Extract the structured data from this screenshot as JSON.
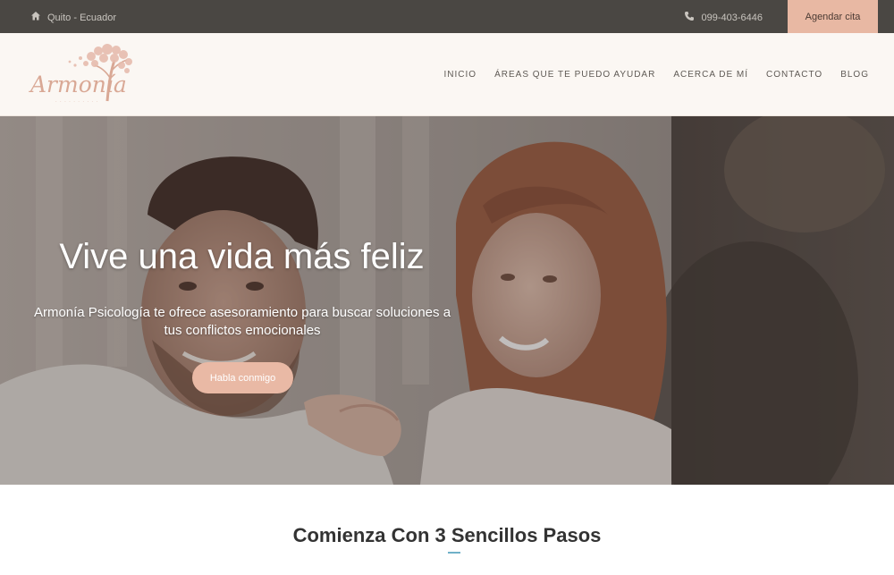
{
  "topbar": {
    "location": "Quito - Ecuador",
    "phone": "099-403-6446",
    "cta_label": "Agendar cita",
    "icons": {
      "location": "home-icon",
      "phone": "phone-icon"
    }
  },
  "header": {
    "logo_text": "Armonía",
    "nav": [
      "INICIO",
      "ÁREAS QUE TE PUEDO AYUDAR",
      "ACERCA DE MÍ",
      "CONTACTO",
      "BLOG"
    ]
  },
  "hero": {
    "title": "Vive una vida más feliz",
    "subtitle": "Armonía Psicología te ofrece asesoramiento para buscar soluciones a tus conflictos emocionales",
    "button_label": "Habla conmigo"
  },
  "section": {
    "title": "Comienza Con 3 Sencillos Pasos"
  },
  "colors": {
    "topbar_bg": "#4a4743",
    "accent": "#e8b8a3",
    "header_bg": "#fbf7f3",
    "underline": "#6fb1c8"
  }
}
